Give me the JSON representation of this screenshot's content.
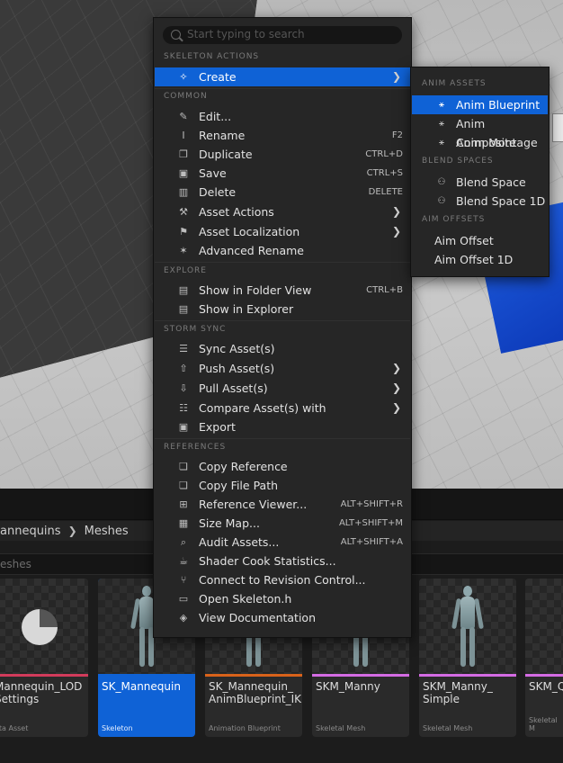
{
  "menu": {
    "search_placeholder": "Start typing to search",
    "sections": {
      "skeleton_actions": "SKELETON ACTIONS",
      "common": "COMMON",
      "explore": "EXPLORE",
      "storm_sync": "STORM SYNC",
      "references": "REFERENCES"
    },
    "create": "Create",
    "common": [
      {
        "label": "Edit...",
        "shortcut": ""
      },
      {
        "label": "Rename",
        "shortcut": "F2"
      },
      {
        "label": "Duplicate",
        "shortcut": "CTRL+D"
      },
      {
        "label": "Save",
        "shortcut": "CTRL+S"
      },
      {
        "label": "Delete",
        "shortcut": "DELETE"
      },
      {
        "label": "Asset Actions",
        "shortcut": ""
      },
      {
        "label": "Asset Localization",
        "shortcut": ""
      },
      {
        "label": "Advanced Rename",
        "shortcut": ""
      }
    ],
    "explore": [
      {
        "label": "Show in Folder View",
        "shortcut": "CTRL+B"
      },
      {
        "label": "Show in Explorer",
        "shortcut": ""
      }
    ],
    "storm_sync": [
      {
        "label": "Sync Asset(s)"
      },
      {
        "label": "Push Asset(s)"
      },
      {
        "label": "Pull Asset(s)"
      },
      {
        "label": "Compare Asset(s) with"
      },
      {
        "label": "Export"
      }
    ],
    "references": [
      {
        "label": "Copy Reference",
        "shortcut": ""
      },
      {
        "label": "Copy File Path",
        "shortcut": ""
      },
      {
        "label": "Reference Viewer...",
        "shortcut": "ALT+SHIFT+R"
      },
      {
        "label": "Size Map...",
        "shortcut": "ALT+SHIFT+M"
      },
      {
        "label": "Audit Assets...",
        "shortcut": "ALT+SHIFT+A"
      },
      {
        "label": "Shader Cook Statistics...",
        "shortcut": ""
      },
      {
        "label": "Connect to Revision Control...",
        "shortcut": ""
      },
      {
        "label": "Open Skeleton.h",
        "shortcut": ""
      },
      {
        "label": "View Documentation",
        "shortcut": ""
      }
    ]
  },
  "submenu": {
    "sections": {
      "anim_assets": "ANIM ASSETS",
      "blend_spaces": "BLEND SPACES",
      "aim_offsets": "AIM OFFSETS"
    },
    "anim_assets": [
      "Anim Blueprint",
      "Anim Composite",
      "Anim Montage"
    ],
    "blend_spaces": [
      "Blend Space",
      "Blend Space 1D"
    ],
    "aim_offsets": [
      "Aim Offset",
      "Aim Offset 1D"
    ]
  },
  "content_browser": {
    "breadcrumb": [
      "annequins",
      "Meshes"
    ],
    "filter_text": "eshes",
    "tiles": [
      {
        "name": "Mannequin_LOD\nSettings",
        "type": "ata Asset",
        "stripe": "#d23b5b"
      },
      {
        "name": "SK_Mannequin",
        "type": "Skeleton",
        "stripe": "#0f62d6"
      },
      {
        "name": "SK_Mannequin_\nAnimBlueprint_IK",
        "type": "Animation Blueprint",
        "stripe": "#d9621a"
      },
      {
        "name": "SKM_Manny",
        "type": "Skeletal Mesh",
        "stripe": "#d46be3"
      },
      {
        "name": "SKM_Manny_\nSimple",
        "type": "Skeletal Mesh",
        "stripe": "#d46be3"
      },
      {
        "name": "SKM_Q",
        "type": "Skeletal M",
        "stripe": "#d46be3"
      }
    ]
  }
}
